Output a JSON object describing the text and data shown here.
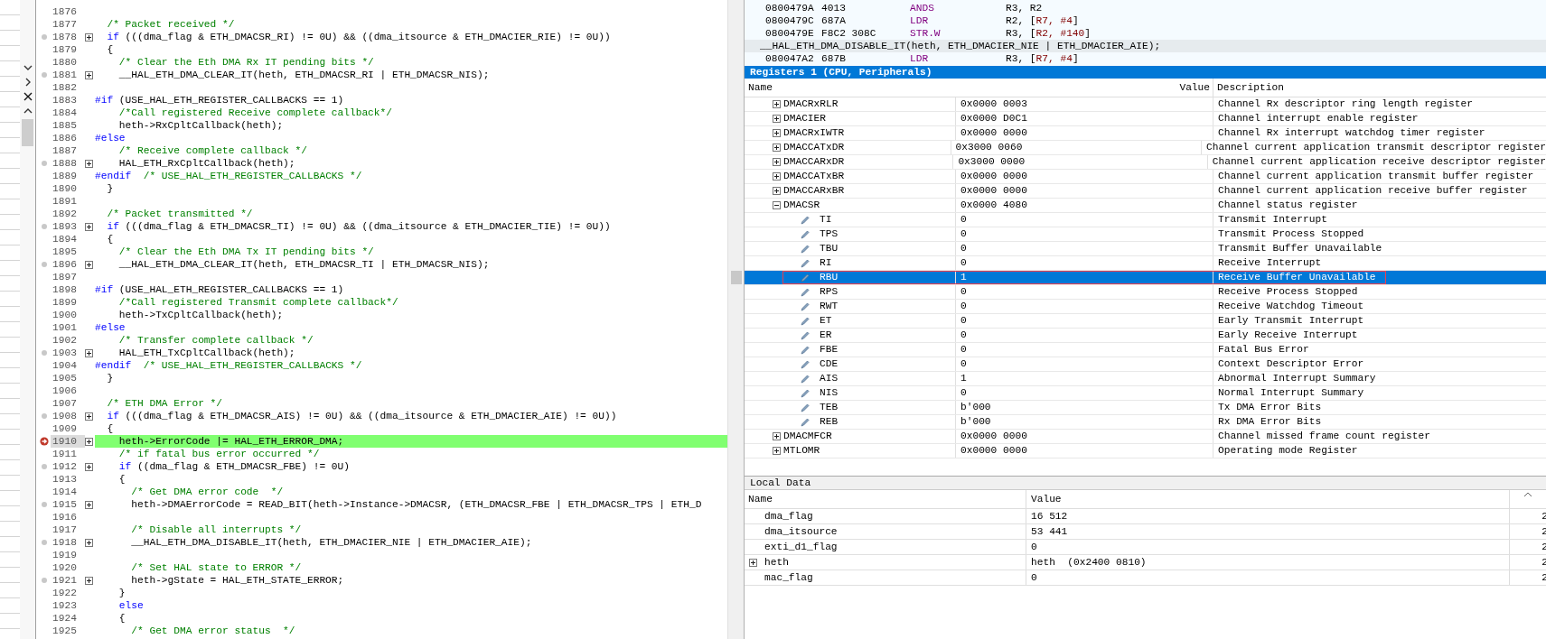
{
  "editor": {
    "lines": [
      {
        "number": "1876"
      },
      {
        "number": "1877",
        "segments": [
          {
            "kind": "comment",
            "text": "  /* Packet received */"
          }
        ]
      },
      {
        "number": "1878",
        "code_line": true,
        "segments": [
          {
            "kind": "keyword",
            "text": "  if"
          },
          {
            "kind": "code",
            "text": " (((dma_flag & ETH_DMACSR_RI) != 0U) && ((dma_itsource & ETH_DMACIER_RIE) != 0U))"
          }
        ]
      },
      {
        "number": "1879",
        "segments": [
          {
            "kind": "code",
            "text": "  {"
          }
        ]
      },
      {
        "number": "1880",
        "segments": [
          {
            "kind": "comment",
            "text": "    /* Clear the Eth DMA Rx IT pending bits */"
          }
        ]
      },
      {
        "number": "1881",
        "code_line": true,
        "segments": [
          {
            "kind": "code",
            "text": "    __HAL_ETH_DMA_CLEAR_IT(heth, ETH_DMACSR_RI | ETH_DMACSR_NIS);"
          }
        ]
      },
      {
        "number": "1882"
      },
      {
        "number": "1883",
        "segments": [
          {
            "kind": "keyword",
            "text": "#if"
          },
          {
            "kind": "code",
            "text": " (USE_HAL_ETH_REGISTER_CALLBACKS == 1)"
          }
        ]
      },
      {
        "number": "1884",
        "segments": [
          {
            "kind": "comment",
            "text": "    /*Call registered Receive complete callback*/"
          }
        ]
      },
      {
        "number": "1885",
        "segments": [
          {
            "kind": "code",
            "text": "    heth->RxCpltCallback(heth);"
          }
        ]
      },
      {
        "number": "1886",
        "segments": [
          {
            "kind": "keyword",
            "text": "#else"
          }
        ]
      },
      {
        "number": "1887",
        "segments": [
          {
            "kind": "comment",
            "text": "    /* Receive complete callback */"
          }
        ]
      },
      {
        "number": "1888",
        "code_line": true,
        "segments": [
          {
            "kind": "code",
            "text": "    HAL_ETH_RxCpltCallback(heth);"
          }
        ]
      },
      {
        "number": "1889",
        "segments": [
          {
            "kind": "keyword",
            "text": "#endif"
          },
          {
            "kind": "comment",
            "text": "  /* USE_HAL_ETH_REGISTER_CALLBACKS */"
          }
        ]
      },
      {
        "number": "1890",
        "segments": [
          {
            "kind": "code",
            "text": "  }"
          }
        ]
      },
      {
        "number": "1891"
      },
      {
        "number": "1892",
        "segments": [
          {
            "kind": "comment",
            "text": "  /* Packet transmitted */"
          }
        ]
      },
      {
        "number": "1893",
        "code_line": true,
        "segments": [
          {
            "kind": "keyword",
            "text": "  if"
          },
          {
            "kind": "code",
            "text": " (((dma_flag & ETH_DMACSR_TI) != 0U) && ((dma_itsource & ETH_DMACIER_TIE) != 0U))"
          }
        ]
      },
      {
        "number": "1894",
        "segments": [
          {
            "kind": "code",
            "text": "  {"
          }
        ]
      },
      {
        "number": "1895",
        "segments": [
          {
            "kind": "comment",
            "text": "    /* Clear the Eth DMA Tx IT pending bits */"
          }
        ]
      },
      {
        "number": "1896",
        "code_line": true,
        "segments": [
          {
            "kind": "code",
            "text": "    __HAL_ETH_DMA_CLEAR_IT(heth, ETH_DMACSR_TI | ETH_DMACSR_NIS);"
          }
        ]
      },
      {
        "number": "1897"
      },
      {
        "number": "1898",
        "segments": [
          {
            "kind": "keyword",
            "text": "#if"
          },
          {
            "kind": "code",
            "text": " (USE_HAL_ETH_REGISTER_CALLBACKS == 1)"
          }
        ]
      },
      {
        "number": "1899",
        "segments": [
          {
            "kind": "comment",
            "text": "    /*Call registered Transmit complete callback*/"
          }
        ]
      },
      {
        "number": "1900",
        "segments": [
          {
            "kind": "code",
            "text": "    heth->TxCpltCallback(heth);"
          }
        ]
      },
      {
        "number": "1901",
        "segments": [
          {
            "kind": "keyword",
            "text": "#else"
          }
        ]
      },
      {
        "number": "1902",
        "segments": [
          {
            "kind": "comment",
            "text": "    /* Transfer complete callback */"
          }
        ]
      },
      {
        "number": "1903",
        "code_line": true,
        "segments": [
          {
            "kind": "code",
            "text": "    HAL_ETH_TxCpltCallback(heth);"
          }
        ]
      },
      {
        "number": "1904",
        "segments": [
          {
            "kind": "keyword",
            "text": "#endif"
          },
          {
            "kind": "comment",
            "text": "  /* USE_HAL_ETH_REGISTER_CALLBACKS */"
          }
        ]
      },
      {
        "number": "1905",
        "segments": [
          {
            "kind": "code",
            "text": "  }"
          }
        ]
      },
      {
        "number": "1906"
      },
      {
        "number": "1907",
        "segments": [
          {
            "kind": "comment",
            "text": "  /* ETH DMA Error */"
          }
        ]
      },
      {
        "number": "1908",
        "code_line": true,
        "segments": [
          {
            "kind": "keyword",
            "text": "  if"
          },
          {
            "kind": "code",
            "text": " (((dma_flag & ETH_DMACSR_AIS) != 0U) && ((dma_itsource & ETH_DMACIER_AIE) != 0U))"
          }
        ]
      },
      {
        "number": "1909",
        "segments": [
          {
            "kind": "code",
            "text": "  {"
          }
        ]
      },
      {
        "number": "1910",
        "code_line": true,
        "current": true,
        "segments": [
          {
            "kind": "code",
            "text": "    heth->ErrorCode |= HAL_ETH_ERROR_DMA;"
          }
        ]
      },
      {
        "number": "1911",
        "segments": [
          {
            "kind": "comment",
            "text": "    /* if fatal bus error occurred */"
          }
        ]
      },
      {
        "number": "1912",
        "code_line": true,
        "segments": [
          {
            "kind": "keyword",
            "text": "    if"
          },
          {
            "kind": "code",
            "text": " ((dma_flag & ETH_DMACSR_FBE) != 0U)"
          }
        ]
      },
      {
        "number": "1913",
        "segments": [
          {
            "kind": "code",
            "text": "    {"
          }
        ]
      },
      {
        "number": "1914",
        "segments": [
          {
            "kind": "comment",
            "text": "      /* Get DMA error code  */"
          }
        ]
      },
      {
        "number": "1915",
        "code_line": true,
        "segments": [
          {
            "kind": "code",
            "text": "      heth->DMAErrorCode = READ_BIT(heth->Instance->DMACSR, (ETH_DMACSR_FBE | ETH_DMACSR_TPS | ETH_D"
          }
        ]
      },
      {
        "number": "1916"
      },
      {
        "number": "1917",
        "segments": [
          {
            "kind": "comment",
            "text": "      /* Disable all interrupts */"
          }
        ]
      },
      {
        "number": "1918",
        "code_line": true,
        "segments": [
          {
            "kind": "code",
            "text": "      __HAL_ETH_DMA_DISABLE_IT(heth, ETH_DMACIER_NIE | ETH_DMACIER_AIE);"
          }
        ]
      },
      {
        "number": "1919"
      },
      {
        "number": "1920",
        "segments": [
          {
            "kind": "comment",
            "text": "      /* Set HAL state to ERROR */"
          }
        ]
      },
      {
        "number": "1921",
        "code_line": true,
        "segments": [
          {
            "kind": "code",
            "text": "      heth->gState = HAL_ETH_STATE_ERROR;"
          }
        ]
      },
      {
        "number": "1922",
        "segments": [
          {
            "kind": "code",
            "text": "    }"
          }
        ]
      },
      {
        "number": "1923",
        "segments": [
          {
            "kind": "keyword",
            "text": "    else"
          }
        ]
      },
      {
        "number": "1924",
        "segments": [
          {
            "kind": "code",
            "text": "    {"
          }
        ]
      },
      {
        "number": "1925",
        "segments": [
          {
            "kind": "comment",
            "text": "      /* Get DMA error status  */"
          }
        ]
      }
    ]
  },
  "disassembly": {
    "rows": [
      {
        "kind": "asm",
        "address": "0800479A",
        "opcode": "4013",
        "mnemonic": "ANDS",
        "operands": [
          {
            "kind": "plain",
            "text": "R3, R2"
          }
        ]
      },
      {
        "kind": "asm",
        "address": "0800479C",
        "opcode": "687A",
        "mnemonic": "LDR",
        "operands": [
          {
            "kind": "plain",
            "text": "R2, ["
          },
          {
            "kind": "immediate",
            "text": "R7, #4"
          },
          {
            "kind": "plain",
            "text": "]"
          }
        ]
      },
      {
        "kind": "asm",
        "address": "0800479E",
        "opcode": "F8C2 308C",
        "mnemonic": "STR.W",
        "operands": [
          {
            "kind": "plain",
            "text": "R3, ["
          },
          {
            "kind": "immediate",
            "text": "R2, #140"
          },
          {
            "kind": "plain",
            "text": "]"
          }
        ]
      },
      {
        "kind": "source",
        "text": "__HAL_ETH_DMA_DISABLE_IT(heth, ETH_DMACIER_NIE | ETH_DMACIER_AIE);"
      },
      {
        "kind": "asm",
        "address": "080047A2",
        "opcode": "687B",
        "mnemonic": "LDR",
        "operands": [
          {
            "kind": "plain",
            "text": "R3, ["
          },
          {
            "kind": "immediate",
            "text": "R7, #4"
          },
          {
            "kind": "plain",
            "text": "]"
          }
        ]
      }
    ]
  },
  "registers": {
    "title": "Registers 1 (CPU, Peripherals)",
    "columns": [
      "Name",
      "Value",
      "Description"
    ],
    "rows": [
      {
        "kind": "register",
        "name": "DMACRxRLR",
        "value": "0x0000 0003",
        "description": "Channel Rx descriptor ring length register",
        "expanded": false,
        "selected": false
      },
      {
        "kind": "register",
        "name": "DMACIER",
        "value": "0x0000 D0C1",
        "description": "Channel interrupt enable register",
        "expanded": false,
        "selected": false
      },
      {
        "kind": "register",
        "name": "DMACRxIWTR",
        "value": "0x0000 0000",
        "description": "Channel Rx interrupt watchdog timer register",
        "expanded": false,
        "selected": false
      },
      {
        "kind": "register",
        "name": "DMACCATxDR",
        "value": "0x3000 0060",
        "description": "Channel current application transmit descriptor register",
        "expanded": false,
        "selected": false
      },
      {
        "kind": "register",
        "name": "DMACCARxDR",
        "value": "0x3000 0000",
        "description": "Channel current application receive descriptor register",
        "expanded": false,
        "selected": false
      },
      {
        "kind": "register",
        "name": "DMACCATxBR",
        "value": "0x0000 0000",
        "description": "Channel current application transmit buffer register",
        "expanded": false,
        "selected": false
      },
      {
        "kind": "register",
        "name": "DMACCARxBR",
        "value": "0x0000 0000",
        "description": "Channel current application receive buffer register",
        "expanded": false,
        "selected": false
      },
      {
        "kind": "register",
        "name": "DMACSR",
        "value": "0x0000 4080",
        "description": "Channel status register",
        "expanded": true,
        "selected": false,
        "children": [
          {
            "kind": "field",
            "name": "TI",
            "value": "0",
            "description": "Transmit Interrupt",
            "selected": false
          },
          {
            "kind": "field",
            "name": "TPS",
            "value": "0",
            "description": "Transmit Process Stopped",
            "selected": false
          },
          {
            "kind": "field",
            "name": "TBU",
            "value": "0",
            "description": "Transmit Buffer Unavailable",
            "selected": false
          },
          {
            "kind": "field",
            "name": "RI",
            "value": "0",
            "description": "Receive Interrupt",
            "selected": false
          },
          {
            "kind": "field",
            "name": "RBU",
            "value": "1",
            "description": "Receive Buffer Unavailable",
            "selected": true
          },
          {
            "kind": "field",
            "name": "RPS",
            "value": "0",
            "description": "Receive Process Stopped",
            "selected": false
          },
          {
            "kind": "field",
            "name": "RWT",
            "value": "0",
            "description": "Receive Watchdog Timeout",
            "selected": false
          },
          {
            "kind": "field",
            "name": "ET",
            "value": "0",
            "description": "Early Transmit Interrupt",
            "selected": false
          },
          {
            "kind": "field",
            "name": "ER",
            "value": "0",
            "description": "Early Receive Interrupt",
            "selected": false
          },
          {
            "kind": "field",
            "name": "FBE",
            "value": "0",
            "description": "Fatal Bus Error",
            "selected": false
          },
          {
            "kind": "field",
            "name": "CDE",
            "value": "0",
            "description": "Context Descriptor Error",
            "selected": false
          },
          {
            "kind": "field",
            "name": "AIS",
            "value": "1",
            "description": "Abnormal Interrupt Summary",
            "selected": false
          },
          {
            "kind": "field",
            "name": "NIS",
            "value": "0",
            "description": "Normal Interrupt Summary",
            "selected": false
          },
          {
            "kind": "field",
            "name": "TEB",
            "value": "b'000",
            "description": "Tx DMA Error Bits",
            "selected": false
          },
          {
            "kind": "field",
            "name": "REB",
            "value": "b'000",
            "description": "Rx DMA Error Bits",
            "selected": false
          }
        ]
      },
      {
        "kind": "register",
        "name": "DMACMFCR",
        "value": "0x0000 0000",
        "description": "Channel missed frame count register",
        "expanded": false,
        "selected": false
      },
      {
        "kind": "register",
        "name": "MTLOMR",
        "value": "0x0000 0000",
        "description": "Operating mode Register",
        "expanded": false,
        "selected": false
      }
    ]
  },
  "local_data": {
    "title": "Local Data",
    "columns": [
      "Name",
      "Value"
    ],
    "rows": [
      {
        "name": "dma_flag",
        "value": "16 512",
        "column_3": "2",
        "expandable": false
      },
      {
        "name": "dma_itsource",
        "value": "53 441",
        "column_3": "2",
        "expandable": false
      },
      {
        "name": "exti_d1_flag",
        "value": "0",
        "column_3": "2",
        "expandable": false
      },
      {
        "name": "heth",
        "value": "heth  (0x2400 0810)",
        "column_3": "2",
        "expandable": true
      },
      {
        "name": "mac_flag",
        "value": "0",
        "column_3": "2",
        "expandable": false
      }
    ]
  }
}
